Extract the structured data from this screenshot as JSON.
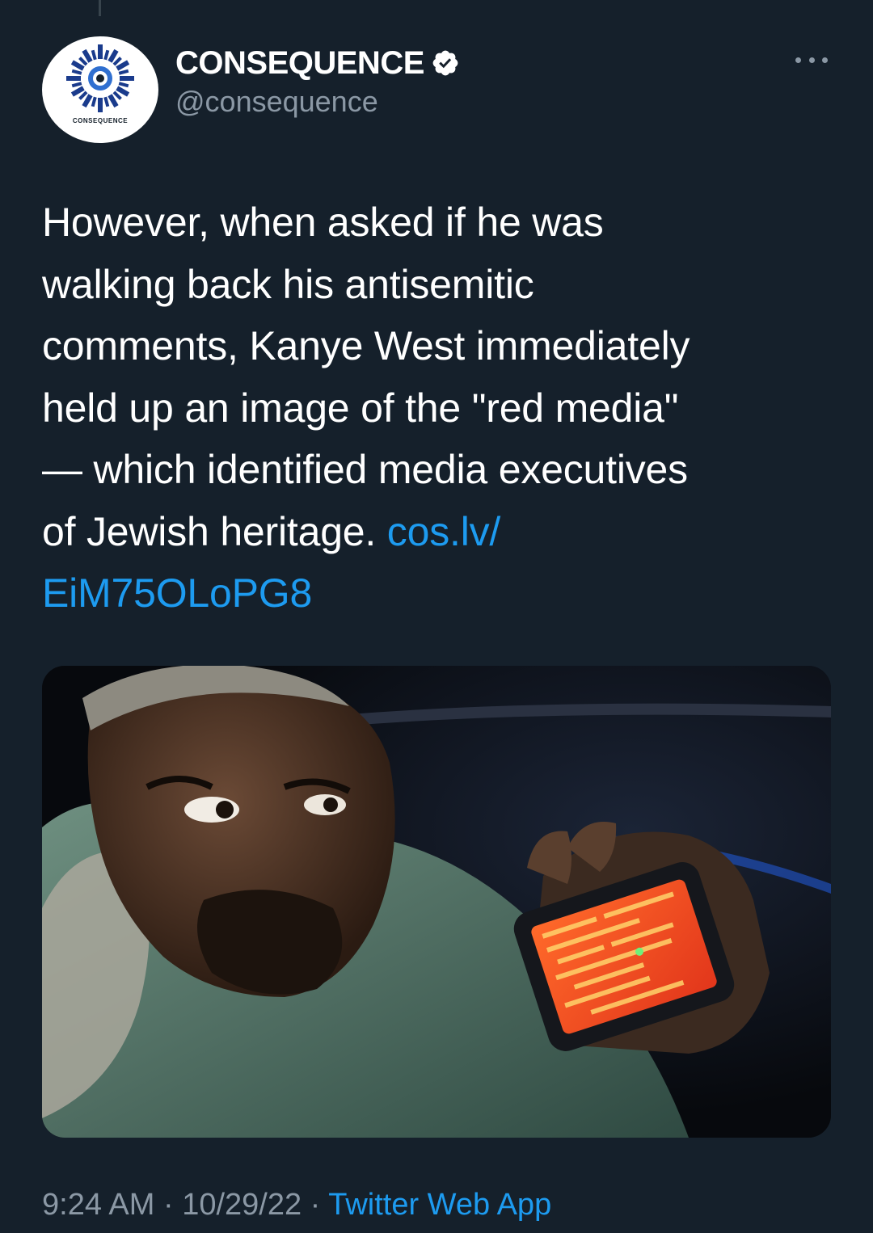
{
  "account": {
    "display_name": "CONSEQUENCE",
    "handle": "@consequence",
    "avatar_wordmark": "CONSEQUENCE",
    "verified": true
  },
  "tweet": {
    "text": "However, when asked if he was\nwalking back his antisemitic\ncomments, Kanye West immediately\nheld up an image of the \"red media\"\n— which identified media executives\nof Jewish heritage. ",
    "link_line1": "cos.lv/",
    "link_line2": "EiM75OLoPG8"
  },
  "meta": {
    "time": "9:24 AM",
    "separator": " · ",
    "date": "10/29/22",
    "source": "Twitter Web App"
  },
  "icons": {
    "verified": "verified-badge-icon",
    "more": "more-options-icon"
  },
  "colors": {
    "background": "#15202b",
    "text": "#ffffff",
    "secondary_text": "#8b98a5",
    "link": "#1d9bf0"
  }
}
